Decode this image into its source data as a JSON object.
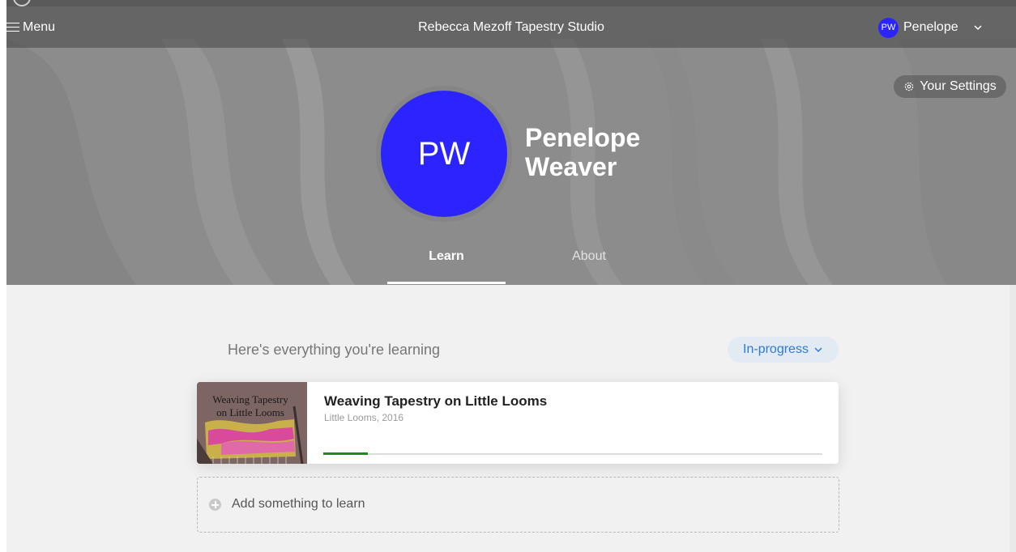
{
  "nav": {
    "menu_label": "Menu",
    "site_title": "Rebecca Mezoff Tapestry Studio",
    "user_initials": "PW",
    "user_name": "Penelope"
  },
  "profile": {
    "settings_label": "Your Settings",
    "initials": "PW",
    "first_name": "Penelope",
    "last_name": "Weaver",
    "avatar_color": "#2b24ff"
  },
  "tabs": [
    {
      "label": "Learn",
      "active": true
    },
    {
      "label": "About",
      "active": false
    }
  ],
  "main": {
    "heading": "Here's everything you're learning",
    "filter_label": "In-progress",
    "add_label": "Add something to learn"
  },
  "courses": [
    {
      "title": "Weaving Tapestry on Little Looms",
      "subtitle": "Little Looms, 2016",
      "thumb_text_line1": "Weaving Tapestry",
      "thumb_text_line2": "on Little Looms",
      "progress_percent": 9
    }
  ],
  "colors": {
    "accent_blue": "#2e7ad8",
    "progress_green": "#1e8a1e"
  }
}
